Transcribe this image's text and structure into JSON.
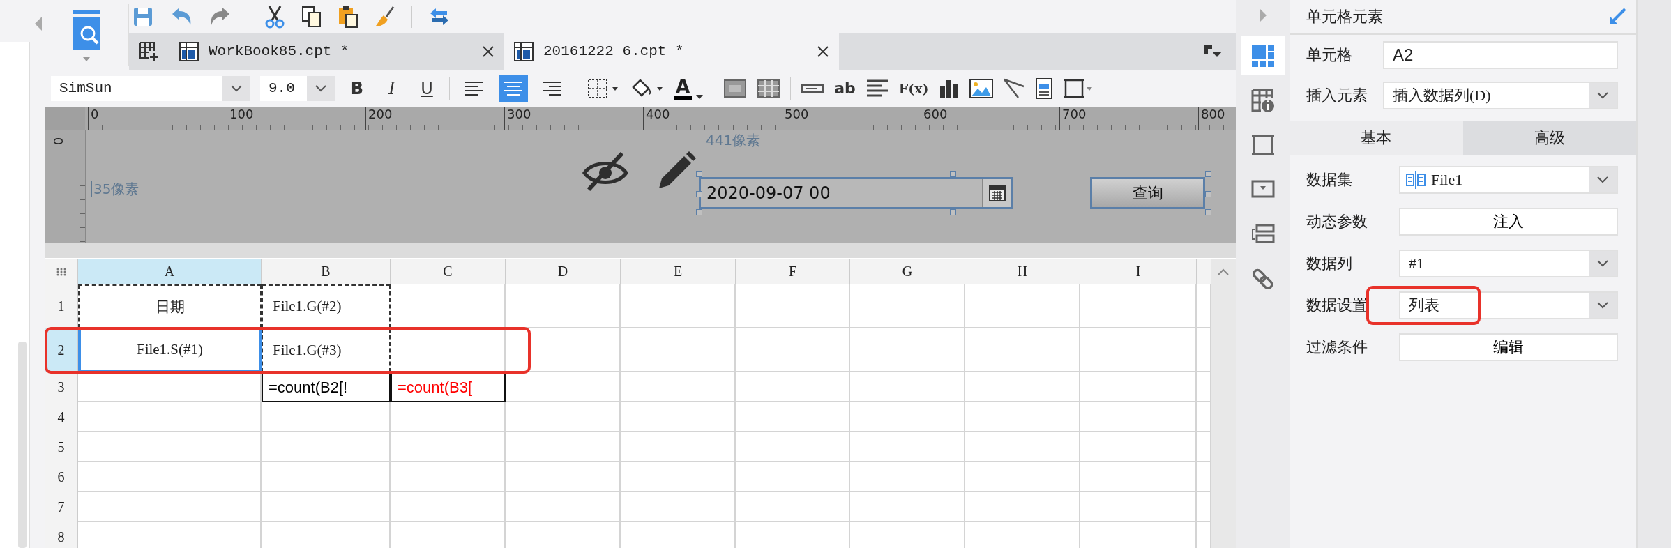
{
  "tabs": [
    {
      "label": "WorkBook85.cpt *",
      "selected": false
    },
    {
      "label": "20161222_6.cpt *",
      "selected": true
    }
  ],
  "format_bar": {
    "font": "SimSun",
    "size": "9.0",
    "style_buttons": [
      "B",
      "I",
      "U"
    ],
    "align_buttons": [
      {
        "kind": "left",
        "selected": false
      },
      {
        "kind": "center",
        "selected": true
      },
      {
        "kind": "right",
        "selected": false
      }
    ],
    "font_color_letter": "A",
    "text_buttons": [
      "ab",
      "F(x)"
    ]
  },
  "ruler": {
    "vertical_mark": "0",
    "marks": [
      "0",
      "100",
      "200",
      "300",
      "400",
      "500",
      "600",
      "700",
      "800"
    ]
  },
  "parameter_panel": {
    "left_label": "35像素",
    "top_label": "441像素",
    "date_field": {
      "value": "2020-09-07 00"
    },
    "query_button": "查询"
  },
  "sheet": {
    "columns": [
      {
        "label": "A",
        "selected": true
      },
      {
        "label": "B",
        "selected": false
      },
      {
        "label": "C",
        "selected": false
      },
      {
        "label": "D",
        "selected": false
      },
      {
        "label": "E",
        "selected": false
      },
      {
        "label": "F",
        "selected": false
      },
      {
        "label": "G",
        "selected": false
      },
      {
        "label": "H",
        "selected": false
      },
      {
        "label": "I",
        "selected": false
      }
    ],
    "rows": [
      {
        "label": "1",
        "selected": false,
        "highlighted": false,
        "cells": [
          {
            "text": "日期",
            "dashed": true
          },
          {
            "text": "File1.G(#2)",
            "dashed": true
          }
        ]
      },
      {
        "label": "2",
        "selected": true,
        "highlighted": true,
        "cells": [
          {
            "text": "File1.S(#1)",
            "dashed": true,
            "selected": true
          },
          {
            "text": "File1.G(#3)",
            "dashed": true
          }
        ]
      },
      {
        "label": "3",
        "selected": false,
        "highlighted": false,
        "cells": [
          {},
          {
            "text": "=count(B2[!",
            "boxed": true,
            "color": "#000000"
          },
          {
            "text": "=count(B3[",
            "boxed": true,
            "color": "#ff0000"
          }
        ]
      },
      {
        "label": "4",
        "selected": false,
        "highlighted": false,
        "cells": []
      },
      {
        "label": "5",
        "selected": false,
        "highlighted": false,
        "cells": []
      },
      {
        "label": "6",
        "selected": false,
        "highlighted": false,
        "cells": []
      },
      {
        "label": "7",
        "selected": false,
        "highlighted": false,
        "cells": []
      },
      {
        "label": "8",
        "selected": false,
        "highlighted": false,
        "cells": []
      }
    ]
  },
  "side_icons": [
    {
      "kind": "layout",
      "selected": true
    },
    {
      "kind": "info",
      "selected": false
    },
    {
      "kind": "frame",
      "selected": false
    },
    {
      "kind": "widget",
      "selected": false
    },
    {
      "kind": "stack",
      "selected": false
    },
    {
      "kind": "link",
      "selected": false
    }
  ],
  "cell_panel": {
    "title": "单元格元素",
    "fields": [
      {
        "label": "单元格",
        "kind": "text",
        "value": "A2"
      },
      {
        "label": "插入元素",
        "kind": "select",
        "value": "插入数据列(D)"
      }
    ],
    "tabs": [
      {
        "label": "基本",
        "selected": true
      },
      {
        "label": "高级",
        "selected": false
      }
    ],
    "settings": [
      {
        "label": "数据集",
        "kind": "dataset",
        "value": "File1",
        "highlighted": false
      },
      {
        "label": "动态参数",
        "kind": "button",
        "value": "注入",
        "highlighted": false
      },
      {
        "label": "数据列",
        "kind": "select",
        "value": "#1",
        "highlighted": false
      },
      {
        "label": "数据设置",
        "kind": "select",
        "value": "列表",
        "highlighted": true
      },
      {
        "label": "过滤条件",
        "kind": "button",
        "value": "编辑",
        "highlighted": false
      }
    ]
  }
}
